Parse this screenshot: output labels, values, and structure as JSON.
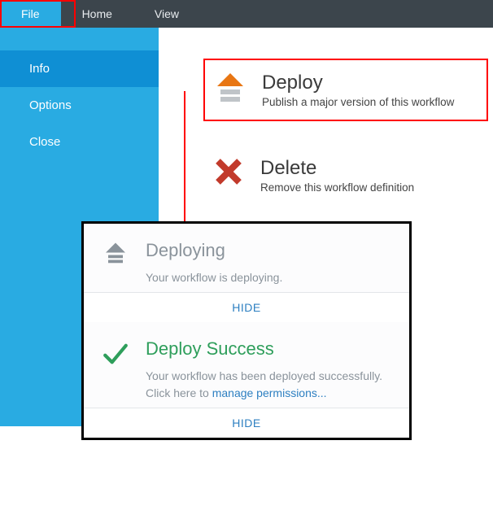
{
  "ribbon": {
    "tabs": [
      "File",
      "Home",
      "View"
    ],
    "active": "File"
  },
  "sidebar": {
    "items": [
      {
        "label": "Info",
        "selected": true
      },
      {
        "label": "Options",
        "selected": false
      },
      {
        "label": "Close",
        "selected": false
      }
    ]
  },
  "actions": {
    "deploy": {
      "title": "Deploy",
      "subtitle": "Publish a major version of this workflow",
      "icon": "deploy-upload-icon",
      "highlight": true,
      "colors": {
        "arrow": "#e87613",
        "base": "#c0c4c8"
      }
    },
    "delete": {
      "title": "Delete",
      "subtitle": "Remove this workflow definition",
      "icon": "delete-x-icon",
      "color": "#c23a2b"
    }
  },
  "status": {
    "deploying": {
      "title": "Deploying",
      "message": "Your workflow is deploying.",
      "hide_label": "HIDE",
      "icon": "deploy-upload-gray-icon"
    },
    "success": {
      "title": "Deploy Success",
      "message_prefix": "Your workflow has been deployed successfully. Click here to ",
      "link_text": "manage permissions...",
      "hide_label": "HIDE",
      "icon": "check-icon",
      "icon_color": "#2e9e5b"
    }
  },
  "annotation": {
    "arrow_color": "#ff0000",
    "highlight_color": "#ff0000"
  }
}
